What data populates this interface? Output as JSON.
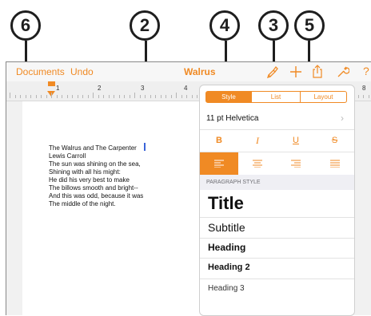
{
  "callouts": [
    "6",
    "2",
    "4",
    "3",
    "5"
  ],
  "toolbar": {
    "documents": "Documents",
    "undo": "Undo",
    "title": "Walrus",
    "help": "?"
  },
  "ruler_numbers": [
    "1",
    "2",
    "3",
    "4",
    "8"
  ],
  "doc_lines": [
    "The Walrus and The Carpenter",
    "Lewis Carroll",
    "The sun was shining on the sea,",
    "Shining with all his might:",
    "He did his very best to make",
    "The billows smooth and bright--",
    "And this was odd, because it was",
    "The middle of the night."
  ],
  "popover": {
    "tabs": [
      "Style",
      "List",
      "Layout"
    ],
    "font": "11 pt Helvetica",
    "section_header": "PARAGRAPH STYLE",
    "styles": [
      "Title",
      "Subtitle",
      "Heading",
      "Heading 2",
      "Heading 3"
    ]
  },
  "colors": {
    "accent": "#f08a24"
  }
}
